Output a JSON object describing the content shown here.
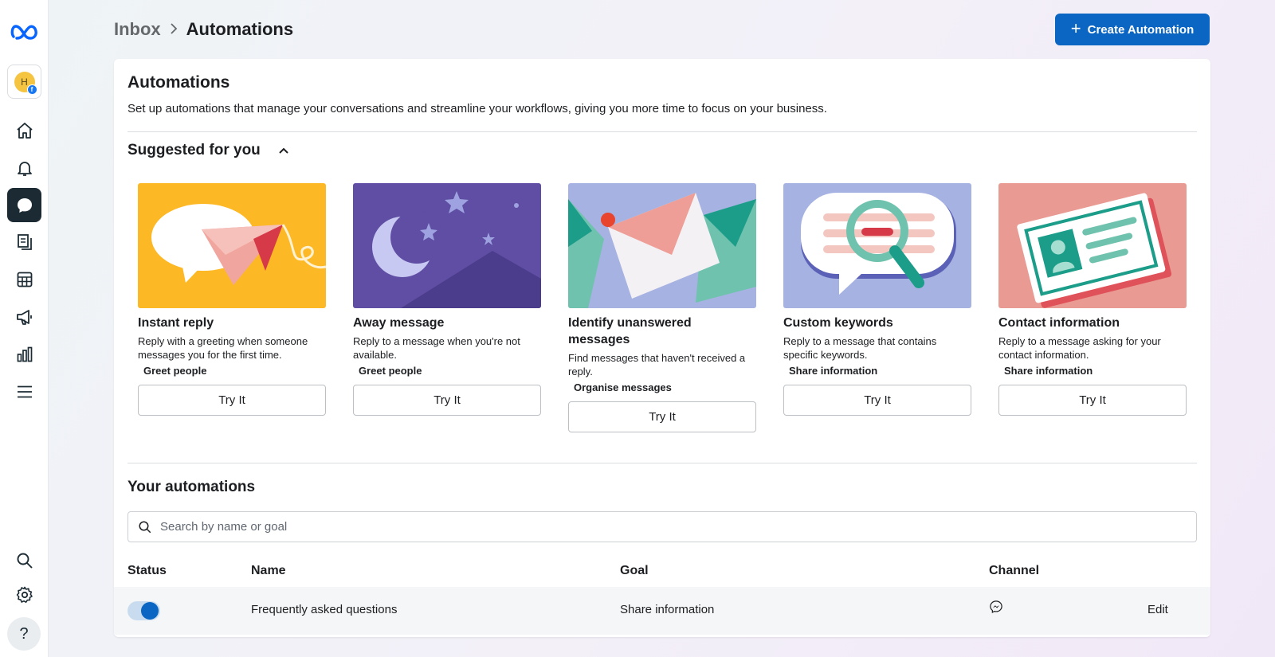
{
  "breadcrumb": {
    "parent": "Inbox",
    "current": "Automations"
  },
  "header": {
    "create_button": "Create Automation"
  },
  "page": {
    "title": "Automations",
    "description": "Set up automations that manage your conversations and streamline your workflows, giving you more time to focus on your business."
  },
  "suggested": {
    "title": "Suggested for you",
    "cards": [
      {
        "title": "Instant reply",
        "description": "Reply with a greeting when someone messages you for the first time.",
        "tag": "Greet people",
        "button": "Try It",
        "bg": "#fdb826"
      },
      {
        "title": "Away message",
        "description": "Reply to a message when you're not available.",
        "tag": "Greet people",
        "button": "Try It",
        "bg": "#5f4ea3"
      },
      {
        "title": "Identify unanswered messages",
        "description": "Find messages that haven't received a reply.",
        "tag": "Organise messages",
        "button": "Try It",
        "bg": "#a6b2e1"
      },
      {
        "title": "Custom keywords",
        "description": "Reply to a message that contains specific keywords.",
        "tag": "Share information",
        "button": "Try It",
        "bg": "#a6b2e1"
      },
      {
        "title": "Contact information",
        "description": "Reply to a message asking for your contact information.",
        "tag": "Share information",
        "button": "Try It",
        "bg": "#e99a93"
      }
    ]
  },
  "automations": {
    "title": "Your automations",
    "search_placeholder": "Search by name or goal",
    "columns": {
      "status": "Status",
      "name": "Name",
      "goal": "Goal",
      "channel": "Channel"
    },
    "rows": [
      {
        "enabled": true,
        "name": "Frequently asked questions",
        "goal": "Share information",
        "channel": "messenger-icon",
        "action": "Edit"
      }
    ]
  },
  "rail": {
    "help": "?",
    "avatar_initial": "H",
    "icons": [
      "meta-logo-icon",
      "home-icon",
      "bell-icon",
      "chat-icon",
      "pages-icon",
      "table-icon",
      "megaphone-icon",
      "bar-chart-icon",
      "menu-icon",
      "search-icon",
      "settings-icon",
      "help-icon"
    ]
  },
  "colors": {
    "accent": "#0a66c2",
    "rail_active": "#1c2b33"
  }
}
